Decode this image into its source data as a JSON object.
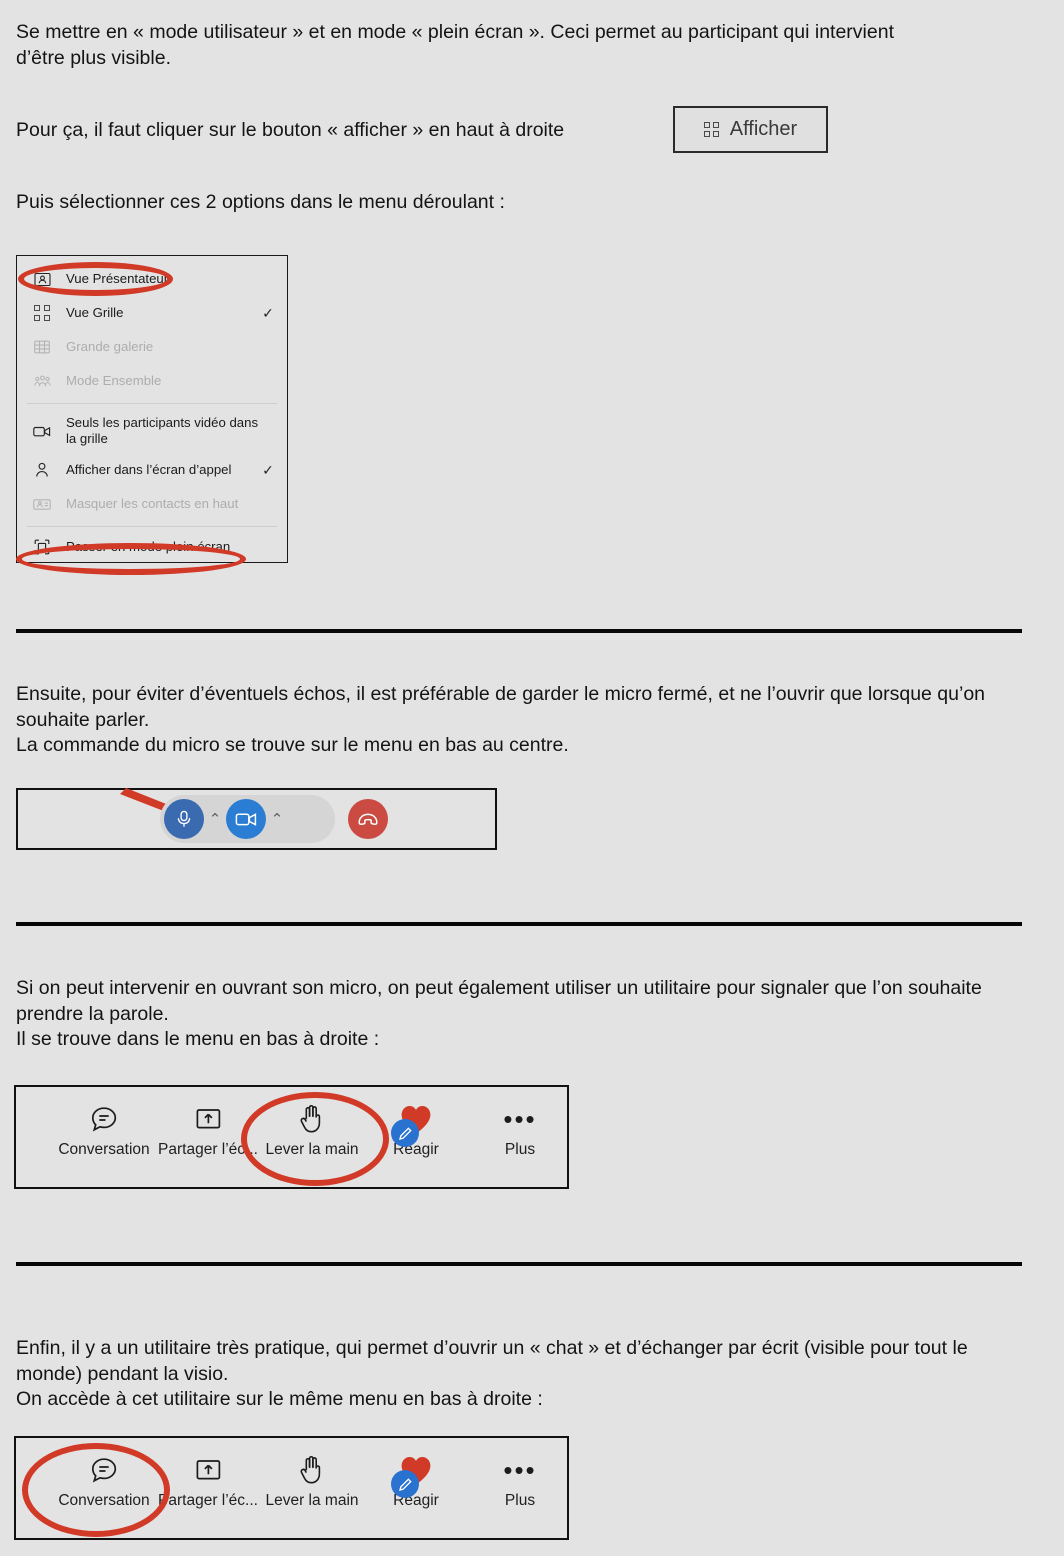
{
  "document": {
    "background_color": "#e3e3e3",
    "accent_red": "#d23a28",
    "paragraphs": [
      {
        "id": "intro",
        "text": "Se mettre en « mode utilisateur » et en mode « plein écran ».  Ceci permet au participant qui intervient d’être plus visible."
      },
      {
        "id": "afficher-instruction",
        "text": "Pour ça, il faut cliquer sur le bouton « afficher » en haut à droite"
      },
      {
        "id": "select-options",
        "text": "Puis sélectionner ces 2 options dans le menu déroulant :"
      },
      {
        "id": "micro-instruction",
        "text": "Ensuite, pour éviter d’éventuels échos, il est préférable de garder le micro fermé, et ne l’ouvrir que lorsque qu’on souhaite parler.\nLa commande du micro se trouve sur le menu en bas au centre."
      },
      {
        "id": "lever-main-instruction",
        "text": "Si on peut intervenir en ouvrant son micro, on peut également utiliser un utilitaire pour signaler que l’on souhaite prendre la parole.\nIl se trouve dans le menu en bas à droite :"
      },
      {
        "id": "chat-instruction",
        "text": "Enfin, il y a un utilitaire très pratique, qui permet d’ouvrir un « chat » et d’échanger par écrit (visible pour tout le monde) pendant la visio.\nOn accède à cet utilitaire sur le même menu en bas à droite :"
      }
    ]
  },
  "afficher_button": {
    "label": "Afficher",
    "icon": "grid-view-icon"
  },
  "dropdown_menu": {
    "items": [
      {
        "label": "Vue Présentateur",
        "icon": "presenter-view-icon",
        "checked": false,
        "disabled": false,
        "highlighted": true
      },
      {
        "label": "Vue Grille",
        "icon": "grid-view-icon",
        "checked": true,
        "disabled": false,
        "highlighted": false
      },
      {
        "label": "Grande galerie",
        "icon": "large-gallery-icon",
        "checked": false,
        "disabled": true,
        "highlighted": false
      },
      {
        "label": "Mode Ensemble",
        "icon": "together-mode-icon",
        "checked": false,
        "disabled": true,
        "highlighted": false
      },
      {
        "label": "Seuls les participants vidéo dans la grille",
        "icon": "video-only-icon",
        "checked": false,
        "disabled": false,
        "highlighted": false
      },
      {
        "label": "Afficher dans l’écran d’appel",
        "icon": "person-icon",
        "checked": true,
        "disabled": false,
        "highlighted": false
      },
      {
        "label": "Masquer les contacts en haut",
        "icon": "hide-roster-icon",
        "checked": false,
        "disabled": true,
        "highlighted": false
      },
      {
        "label": "Passer en mode plein écran",
        "icon": "fullscreen-icon",
        "checked": false,
        "disabled": false,
        "highlighted": true
      }
    ],
    "check_glyph": "✓"
  },
  "call_bar": {
    "mic_button": {
      "name": "microphone-button",
      "color": "#3a6ab0"
    },
    "mic_chevron": {
      "name": "mic-options-chevron",
      "glyph": "⌃"
    },
    "camera_button": {
      "name": "camera-button",
      "color": "#2b7cd3"
    },
    "cam_chevron": {
      "name": "camera-options-chevron",
      "glyph": "⌃"
    },
    "hangup_button": {
      "name": "hang-up-button",
      "color": "#cb4a41"
    },
    "arrow": {
      "name": "red-pointer-arrow",
      "color": "#d23a28"
    }
  },
  "teams_toolbar": {
    "items": [
      {
        "label": "Conversation",
        "icon": "chat-icon"
      },
      {
        "label": "Partager l’éc...",
        "icon": "share-screen-icon"
      },
      {
        "label": "Lever la main",
        "icon": "raise-hand-icon"
      },
      {
        "label": "Réagir",
        "icon": "heart-reaction-icon",
        "badge_icon": "pencil-icon"
      },
      {
        "label": "Plus",
        "icon": "more-options-icon"
      }
    ],
    "highlight_first": "lever-la-main",
    "highlight_second": "conversation"
  }
}
